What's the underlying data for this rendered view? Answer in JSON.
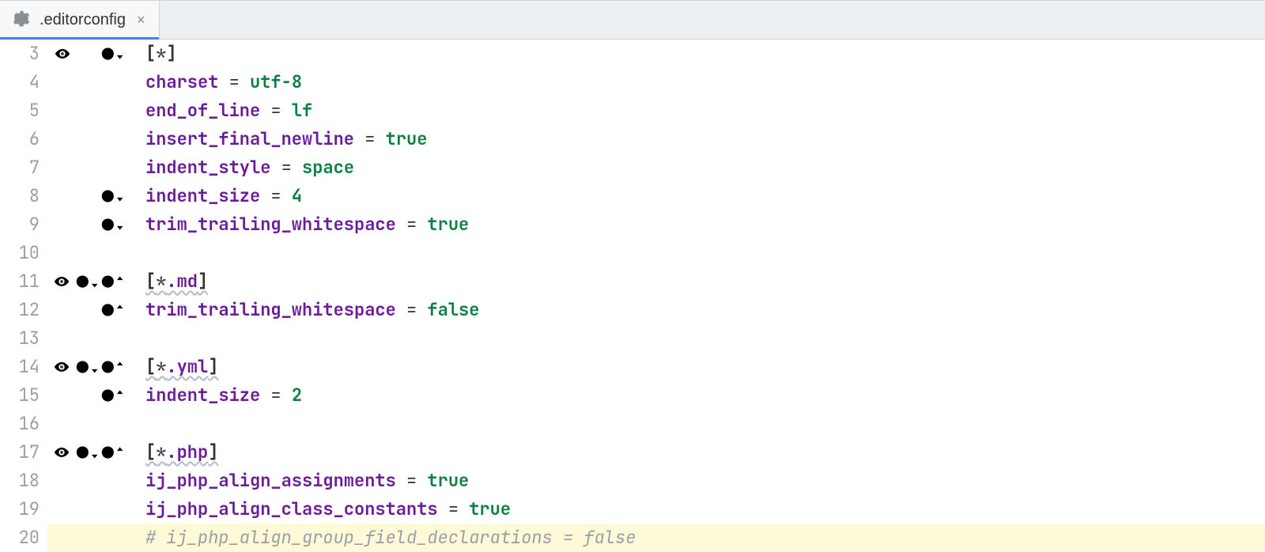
{
  "tab": {
    "filename": ".editorconfig"
  },
  "lines": [
    {
      "num": "3",
      "icons": [
        "eye",
        null,
        "disc_down_gray"
      ],
      "kind": "section",
      "section": "[*]"
    },
    {
      "num": "4",
      "icons": [
        null,
        null,
        null
      ],
      "kind": "assign",
      "key": "charset",
      "val": "utf-8"
    },
    {
      "num": "5",
      "icons": [
        null,
        null,
        null
      ],
      "kind": "assign",
      "key": "end_of_line",
      "val": "lf"
    },
    {
      "num": "6",
      "icons": [
        null,
        null,
        null
      ],
      "kind": "assign",
      "key": "insert_final_newline",
      "val": "true"
    },
    {
      "num": "7",
      "icons": [
        null,
        null,
        null
      ],
      "kind": "assign",
      "key": "indent_style",
      "val": "space"
    },
    {
      "num": "8",
      "icons": [
        null,
        null,
        "disc_down_gray"
      ],
      "kind": "assign",
      "key": "indent_size",
      "val": "4"
    },
    {
      "num": "9",
      "icons": [
        null,
        null,
        "disc_down_gray"
      ],
      "kind": "assign",
      "key": "trim_trailing_whitespace",
      "val": "true"
    },
    {
      "num": "10",
      "icons": [
        null,
        null,
        null
      ],
      "kind": "blank"
    },
    {
      "num": "11",
      "icons": [
        "eye",
        "disc_down_dashed",
        "disc_up"
      ],
      "kind": "section",
      "section": "[*.md]",
      "underline": true
    },
    {
      "num": "12",
      "icons": [
        null,
        null,
        "disc_up"
      ],
      "kind": "assign",
      "key": "trim_trailing_whitespace",
      "val": "false"
    },
    {
      "num": "13",
      "icons": [
        null,
        null,
        null
      ],
      "kind": "blank"
    },
    {
      "num": "14",
      "icons": [
        "eye",
        "disc_down_dashed",
        "disc_up"
      ],
      "kind": "section",
      "section": "[*.yml]",
      "underline": true
    },
    {
      "num": "15",
      "icons": [
        null,
        null,
        "disc_up"
      ],
      "kind": "assign",
      "key": "indent_size",
      "val": "2"
    },
    {
      "num": "16",
      "icons": [
        null,
        null,
        null
      ],
      "kind": "blank"
    },
    {
      "num": "17",
      "icons": [
        "eye",
        "disc_down_dashed",
        "disc_up"
      ],
      "kind": "section",
      "section": "[*.php]",
      "underline": true
    },
    {
      "num": "18",
      "icons": [
        null,
        null,
        null
      ],
      "kind": "assign",
      "key": "ij_php_align_assignments",
      "val": "true"
    },
    {
      "num": "19",
      "icons": [
        null,
        null,
        null
      ],
      "kind": "assign",
      "key": "ij_php_align_class_constants",
      "val": "true"
    },
    {
      "num": "20",
      "icons": [
        null,
        null,
        null
      ],
      "kind": "comment",
      "text": "# ij_php_align_group_field_declarations = false",
      "highlight": true
    }
  ]
}
